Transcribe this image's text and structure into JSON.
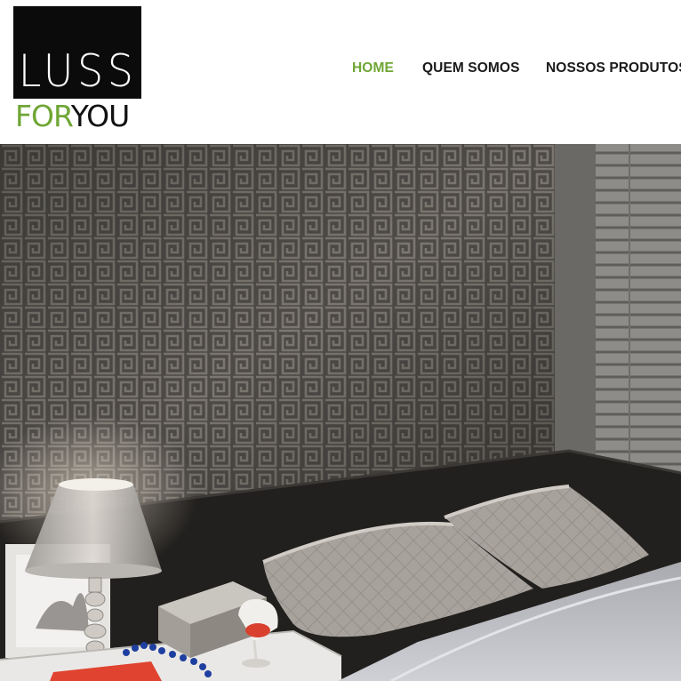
{
  "logo": {
    "main_text": "LUSS",
    "sub_text_for": "FOR",
    "sub_text_you": "YOU",
    "box_color": "#0b0b0b",
    "accent_color": "#6fa635"
  },
  "nav": {
    "items": [
      {
        "label": "HOME",
        "active": true
      },
      {
        "label": "QUEM SOMOS",
        "active": false
      },
      {
        "label": "NOSSOS PRODUTOS",
        "active": false
      }
    ],
    "active_color": "#6fa635",
    "text_color": "#1a1a1a"
  },
  "hero": {
    "image_subject": "bedroom-photo",
    "wall_color": "#57544f",
    "headboard_color": "#22201e"
  }
}
